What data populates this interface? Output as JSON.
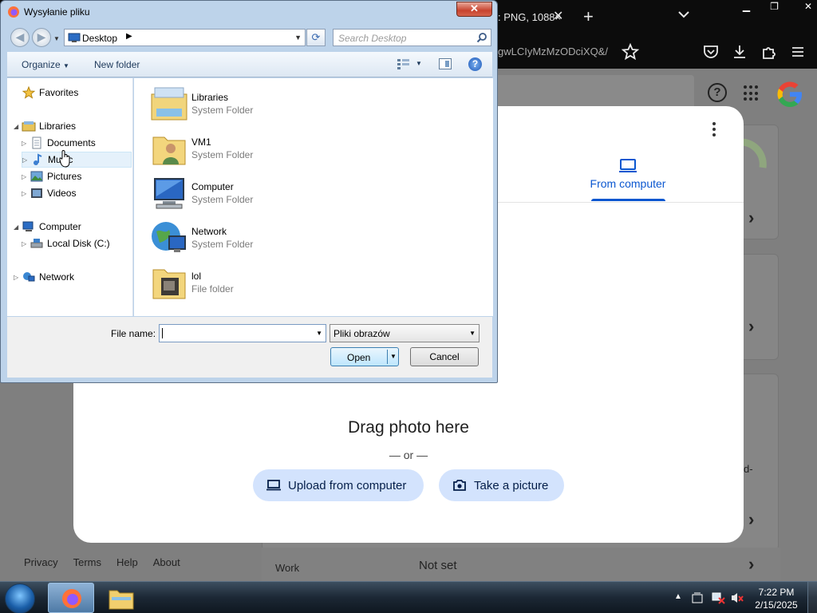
{
  "browser": {
    "tab_title": ": PNG, 1088×",
    "url_fragment": "gwLCIyMzMzODciXQ&/"
  },
  "lens": {
    "tab_from_computer": "From computer",
    "drag_text": "Drag photo here",
    "or_text": "— or —",
    "upload_button": "Upload from computer",
    "take_picture_button": "Take a picture"
  },
  "side": {
    "work_label": "Work",
    "work_value": "Not set",
    "partial": "d-"
  },
  "footer": {
    "privacy": "Privacy",
    "terms": "Terms",
    "help": "Help",
    "about": "About"
  },
  "dialog": {
    "title": "Wysyłanie pliku",
    "address_crumb": "Desktop",
    "search_placeholder": "Search Desktop",
    "organize": "Organize",
    "new_folder": "New folder",
    "nav": {
      "favorites": "Favorites",
      "libraries": "Libraries",
      "documents": "Documents",
      "music": "Music",
      "pictures": "Pictures",
      "videos": "Videos",
      "computer": "Computer",
      "local_disk": "Local Disk (C:)",
      "network": "Network"
    },
    "files": [
      {
        "name": "Libraries",
        "type": "System Folder"
      },
      {
        "name": "VM1",
        "type": "System Folder"
      },
      {
        "name": "Computer",
        "type": "System Folder"
      },
      {
        "name": "Network",
        "type": "System Folder"
      },
      {
        "name": "lol",
        "type": "File folder"
      }
    ],
    "file_name_label": "File name:",
    "file_name_value": "",
    "file_type": "Pliki obrazów",
    "open_button": "Open",
    "cancel_button": "Cancel"
  },
  "taskbar": {
    "time": "7:22 PM",
    "date": "2/15/2025"
  },
  "colors": {
    "google_blue": "#0b57d0",
    "pill_bg": "#d3e3fd",
    "dialog_frame": "#bdd3ea"
  }
}
